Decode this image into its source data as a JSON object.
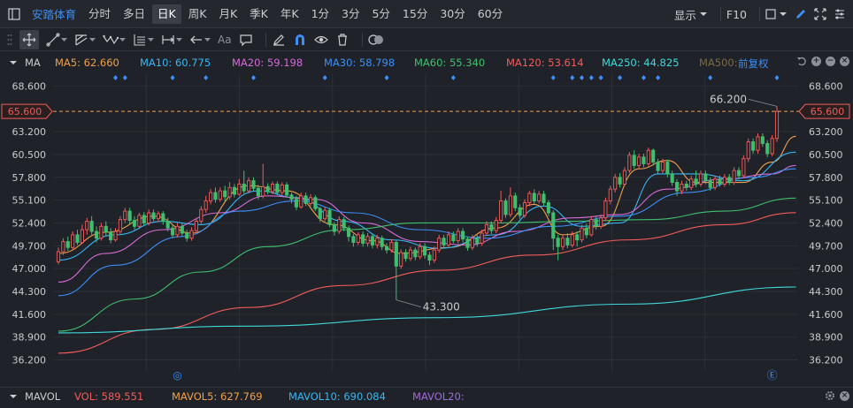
{
  "topbar": {
    "stock_name": "安踏体育",
    "periods": [
      "分时",
      "多日",
      "日K",
      "周K",
      "月K",
      "季K",
      "年K",
      "1分",
      "3分",
      "5分",
      "15分",
      "30分",
      "60分"
    ],
    "active_period": "日K",
    "display_label": "显示",
    "f10_label": "F10"
  },
  "toolbar": {
    "text_tool_label": "Aa"
  },
  "ma_legend": {
    "label": "MA",
    "items": [
      {
        "text": "MA5: 62.660",
        "color": "#f0a04b"
      },
      {
        "text": "MA10: 60.775",
        "color": "#38b6f2"
      },
      {
        "text": "MA20: 59.198",
        "color": "#d66bd6"
      },
      {
        "text": "MA30: 58.798",
        "color": "#3d8ef7"
      },
      {
        "text": "MA60: 55.340",
        "color": "#3fbf6e"
      },
      {
        "text": "MA120: 53.614",
        "color": "#f25b5b"
      },
      {
        "text": "MA250: 44.825",
        "color": "#3fd9d9"
      },
      {
        "text": "MA500:",
        "color": "#7a6a45"
      }
    ],
    "adjust_label": "前复权"
  },
  "vol_legend": {
    "label": "MAVOL",
    "items": [
      {
        "text": "VOL: 589.551",
        "color": "#f25b5b"
      },
      {
        "text": "MAVOL5: 627.769",
        "color": "#f0a04b"
      },
      {
        "text": "MAVOL10: 690.084",
        "color": "#38b6f2"
      },
      {
        "text": "MAVOL20:",
        "color": "#a06bd6"
      }
    ]
  },
  "colors": {
    "up": "#f25b5b",
    "down": "#3fbf6e",
    "grid": "#2b3036",
    "axis_text": "#c9ccd1",
    "accent": "#3d8ef7",
    "crosshair": "#f0a04b"
  },
  "chart_data": {
    "type": "candlestick",
    "ylim": [
      34.9,
      70.0
    ],
    "y_ticks": [
      "68.600",
      "65.600",
      "63.200",
      "60.500",
      "57.800",
      "55.100",
      "52.400",
      "49.700",
      "47.000",
      "44.300",
      "41.600",
      "38.900",
      "36.200"
    ],
    "current_price": "65.600",
    "max_label": "66.200",
    "min_label": "43.300",
    "candles": [
      [
        47.8,
        49.0,
        47.5,
        49.5
      ],
      [
        49.0,
        50.2,
        48.6,
        50.6
      ],
      [
        50.2,
        49.5,
        49.1,
        50.8
      ],
      [
        49.5,
        51.0,
        49.2,
        51.4
      ],
      [
        51.0,
        50.1,
        49.8,
        51.6
      ],
      [
        50.1,
        51.6,
        49.9,
        52.2
      ],
      [
        51.6,
        52.6,
        51.0,
        53.0
      ],
      [
        52.6,
        51.4,
        51.0,
        53.2
      ],
      [
        51.4,
        50.6,
        50.1,
        52.0
      ],
      [
        50.6,
        52.0,
        50.3,
        52.4
      ],
      [
        52.0,
        51.3,
        50.9,
        52.6
      ],
      [
        51.3,
        50.4,
        50.0,
        51.8
      ],
      [
        50.4,
        51.4,
        50.2,
        51.8
      ],
      [
        51.4,
        52.8,
        51.1,
        53.2
      ],
      [
        52.8,
        53.8,
        52.4,
        54.2
      ],
      [
        53.8,
        52.7,
        52.3,
        54.2
      ],
      [
        52.7,
        52.0,
        51.6,
        53.2
      ],
      [
        52.0,
        53.3,
        51.7,
        53.6
      ],
      [
        53.3,
        52.4,
        52.1,
        53.7
      ],
      [
        52.4,
        53.6,
        52.1,
        54.0
      ],
      [
        53.6,
        52.9,
        52.6,
        54.0
      ],
      [
        52.9,
        53.5,
        52.5,
        53.8
      ],
      [
        53.5,
        52.6,
        52.2,
        53.8
      ],
      [
        52.6,
        51.8,
        51.4,
        53.0
      ],
      [
        51.8,
        51.0,
        50.6,
        52.2
      ],
      [
        51.0,
        52.0,
        50.7,
        52.4
      ],
      [
        52.0,
        51.2,
        50.8,
        52.4
      ],
      [
        51.2,
        50.6,
        50.2,
        51.6
      ],
      [
        50.6,
        51.5,
        50.3,
        51.9
      ],
      [
        51.5,
        52.6,
        51.2,
        53.0
      ],
      [
        52.6,
        54.0,
        52.3,
        54.4
      ],
      [
        54.0,
        55.0,
        53.6,
        55.6
      ],
      [
        55.0,
        56.0,
        54.6,
        56.4
      ],
      [
        56.0,
        55.2,
        54.8,
        56.6
      ],
      [
        55.2,
        56.2,
        54.9,
        56.6
      ],
      [
        56.2,
        55.5,
        55.0,
        56.8
      ],
      [
        55.5,
        56.6,
        55.2,
        57.2
      ],
      [
        56.6,
        55.8,
        55.4,
        57.0
      ],
      [
        55.8,
        57.0,
        55.6,
        57.6
      ],
      [
        57.0,
        56.2,
        55.9,
        58.6
      ],
      [
        56.2,
        57.4,
        55.9,
        57.8
      ],
      [
        57.4,
        56.5,
        56.2,
        57.8
      ],
      [
        56.5,
        55.6,
        55.2,
        56.9
      ],
      [
        55.6,
        56.7,
        55.3,
        59.4
      ],
      [
        56.7,
        56.1,
        55.8,
        57.1
      ],
      [
        56.1,
        57.0,
        55.8,
        57.3
      ],
      [
        57.0,
        56.0,
        55.7,
        57.3
      ],
      [
        56.0,
        56.9,
        55.7,
        57.2
      ],
      [
        56.9,
        55.7,
        55.4,
        57.2
      ],
      [
        55.7,
        55.2,
        54.7,
        56.0
      ],
      [
        55.2,
        54.3,
        53.9,
        55.6
      ],
      [
        54.3,
        55.6,
        54.1,
        56.0
      ],
      [
        55.6,
        54.7,
        54.4,
        56.0
      ],
      [
        54.7,
        55.4,
        54.4,
        55.8
      ],
      [
        55.4,
        54.1,
        53.8,
        55.7
      ],
      [
        54.1,
        52.9,
        52.5,
        54.3
      ],
      [
        52.9,
        53.9,
        52.6,
        54.3
      ],
      [
        53.9,
        52.2,
        51.9,
        54.2
      ],
      [
        52.2,
        51.4,
        50.9,
        52.5
      ],
      [
        51.4,
        52.8,
        51.1,
        53.2
      ],
      [
        52.8,
        51.8,
        51.4,
        53.1
      ],
      [
        51.8,
        50.8,
        50.2,
        52.1
      ],
      [
        50.8,
        50.1,
        49.6,
        51.1
      ],
      [
        50.1,
        51.0,
        49.8,
        51.3
      ],
      [
        51.0,
        50.0,
        49.6,
        51.4
      ],
      [
        50.0,
        50.8,
        49.6,
        51.2
      ],
      [
        50.8,
        49.8,
        49.4,
        51.1
      ],
      [
        49.8,
        50.6,
        49.4,
        51.0
      ],
      [
        50.6,
        49.6,
        49.2,
        50.9
      ],
      [
        49.6,
        49.2,
        48.8,
        50.0
      ],
      [
        49.2,
        50.1,
        48.9,
        50.5
      ],
      [
        50.1,
        47.3,
        43.3,
        50.4
      ],
      [
        47.3,
        48.9,
        47.0,
        49.3
      ],
      [
        48.9,
        48.2,
        47.8,
        49.3
      ],
      [
        48.2,
        49.2,
        47.9,
        49.6
      ],
      [
        49.2,
        48.4,
        48.0,
        49.5
      ],
      [
        48.4,
        49.6,
        48.1,
        50.0
      ],
      [
        49.6,
        48.6,
        48.2,
        50.0
      ],
      [
        48.6,
        48.0,
        47.4,
        49.0
      ],
      [
        48.0,
        49.2,
        47.7,
        49.6
      ],
      [
        49.2,
        50.6,
        48.9,
        51.0
      ],
      [
        50.6,
        49.8,
        49.4,
        51.0
      ],
      [
        49.8,
        51.0,
        49.6,
        51.4
      ],
      [
        51.0,
        50.3,
        50.0,
        51.4
      ],
      [
        50.3,
        51.4,
        50.0,
        51.8
      ],
      [
        51.4,
        50.5,
        50.1,
        51.8
      ],
      [
        50.5,
        49.5,
        49.1,
        50.8
      ],
      [
        49.5,
        50.6,
        49.2,
        51.0
      ],
      [
        50.6,
        50.0,
        49.6,
        51.0
      ],
      [
        50.0,
        51.2,
        49.7,
        51.6
      ],
      [
        51.2,
        52.2,
        50.9,
        52.6
      ],
      [
        52.2,
        51.5,
        51.1,
        52.6
      ],
      [
        51.5,
        52.7,
        51.2,
        53.1
      ],
      [
        52.7,
        55.0,
        52.4,
        56.2
      ],
      [
        55.0,
        53.4,
        53.0,
        55.3
      ],
      [
        53.4,
        55.6,
        53.1,
        56.6
      ],
      [
        55.6,
        54.2,
        53.8,
        56.0
      ],
      [
        54.2,
        53.3,
        52.9,
        54.6
      ],
      [
        53.3,
        54.8,
        53.0,
        55.2
      ],
      [
        54.8,
        55.9,
        54.4,
        56.2
      ],
      [
        55.9,
        55.0,
        54.6,
        56.4
      ],
      [
        55.0,
        55.8,
        54.7,
        56.2
      ],
      [
        55.8,
        54.8,
        54.4,
        56.2
      ],
      [
        54.8,
        53.6,
        53.2,
        55.1
      ],
      [
        53.6,
        50.6,
        49.2,
        53.9
      ],
      [
        50.6,
        49.6,
        48.0,
        51.0
      ],
      [
        49.6,
        50.6,
        49.2,
        51.0
      ],
      [
        50.6,
        49.8,
        49.4,
        51.2
      ],
      [
        49.8,
        51.0,
        49.5,
        51.4
      ],
      [
        51.0,
        50.4,
        49.6,
        51.4
      ],
      [
        50.4,
        51.8,
        50.1,
        52.2
      ],
      [
        51.8,
        51.0,
        50.6,
        52.3
      ],
      [
        51.0,
        52.8,
        50.8,
        53.2
      ],
      [
        52.8,
        52.0,
        51.6,
        53.2
      ],
      [
        52.0,
        53.0,
        51.7,
        53.4
      ],
      [
        53.0,
        55.0,
        52.7,
        55.4
      ],
      [
        55.0,
        56.4,
        54.6,
        56.8
      ],
      [
        56.4,
        57.8,
        56.0,
        58.2
      ],
      [
        57.8,
        57.0,
        56.6,
        58.3
      ],
      [
        57.0,
        58.6,
        56.8,
        59.0
      ],
      [
        58.6,
        60.4,
        58.3,
        60.8
      ],
      [
        60.4,
        59.2,
        58.8,
        61.0
      ],
      [
        59.2,
        60.2,
        58.8,
        60.6
      ],
      [
        60.2,
        59.4,
        59.0,
        60.6
      ],
      [
        59.4,
        61.0,
        59.1,
        61.3
      ],
      [
        61.0,
        59.6,
        59.2,
        61.2
      ],
      [
        59.6,
        58.6,
        58.2,
        60.0
      ],
      [
        58.6,
        59.6,
        58.3,
        60.0
      ],
      [
        59.6,
        58.2,
        57.8,
        59.9
      ],
      [
        58.2,
        57.2,
        56.8,
        58.6
      ],
      [
        57.2,
        56.2,
        55.6,
        57.6
      ],
      [
        56.2,
        57.0,
        55.8,
        57.4
      ],
      [
        57.0,
        56.6,
        56.2,
        57.4
      ],
      [
        56.6,
        57.6,
        56.3,
        58.0
      ],
      [
        57.6,
        57.0,
        56.6,
        58.6
      ],
      [
        57.0,
        58.2,
        56.7,
        58.6
      ],
      [
        58.2,
        57.4,
        57.0,
        58.6
      ],
      [
        57.4,
        56.6,
        56.2,
        57.8
      ],
      [
        56.6,
        57.6,
        56.3,
        58.0
      ],
      [
        57.6,
        57.0,
        56.7,
        58.0
      ],
      [
        57.0,
        57.8,
        56.7,
        58.2
      ],
      [
        57.8,
        57.2,
        56.9,
        58.2
      ],
      [
        57.2,
        58.6,
        56.9,
        59.0
      ],
      [
        58.6,
        58.0,
        57.6,
        59.0
      ],
      [
        58.0,
        60.0,
        57.7,
        60.4
      ],
      [
        60.0,
        62.0,
        59.6,
        62.4
      ],
      [
        62.0,
        61.0,
        60.6,
        62.4
      ],
      [
        61.0,
        62.6,
        60.6,
        63.0
      ],
      [
        62.6,
        61.8,
        61.4,
        63.0
      ],
      [
        61.8,
        60.6,
        60.2,
        62.2
      ],
      [
        60.6,
        62.4,
        60.3,
        62.8
      ],
      [
        62.4,
        65.6,
        62.0,
        66.2
      ]
    ],
    "ma_series": {
      "MA5": [
        [
          0,
          48.8
        ],
        [
          10,
          51.3
        ],
        [
          20,
          53.2
        ],
        [
          28,
          51.2
        ],
        [
          40,
          56.8
        ],
        [
          48,
          56.2
        ],
        [
          58,
          52.2
        ],
        [
          66,
          50.3
        ],
        [
          72,
          48.8
        ],
        [
          82,
          49.5
        ],
        [
          92,
          51.8
        ],
        [
          100,
          54.6
        ],
        [
          106,
          51.0
        ],
        [
          114,
          52.0
        ],
        [
          122,
          58.8
        ],
        [
          128,
          59.8
        ],
        [
          134,
          57.2
        ],
        [
          144,
          57.2
        ],
        [
          150,
          59.6
        ],
        [
          155,
          62.66
        ]
      ],
      "MA10": [
        [
          0,
          48.0
        ],
        [
          12,
          51.0
        ],
        [
          22,
          52.6
        ],
        [
          30,
          52.2
        ],
        [
          42,
          56.2
        ],
        [
          50,
          55.4
        ],
        [
          60,
          52.6
        ],
        [
          70,
          50.4
        ],
        [
          80,
          49.4
        ],
        [
          92,
          51.0
        ],
        [
          102,
          54.4
        ],
        [
          110,
          52.0
        ],
        [
          118,
          52.4
        ],
        [
          126,
          58.2
        ],
        [
          134,
          58.2
        ],
        [
          144,
          57.4
        ],
        [
          155,
          60.775
        ]
      ],
      "MA20": [
        [
          0,
          45.4
        ],
        [
          10,
          48.8
        ],
        [
          22,
          51.6
        ],
        [
          34,
          53.6
        ],
        [
          44,
          55.6
        ],
        [
          54,
          55.2
        ],
        [
          64,
          52.4
        ],
        [
          76,
          50.2
        ],
        [
          86,
          49.8
        ],
        [
          96,
          51.4
        ],
        [
          108,
          53.0
        ],
        [
          118,
          53.4
        ],
        [
          128,
          56.4
        ],
        [
          140,
          57.6
        ],
        [
          150,
          58.2
        ],
        [
          155,
          59.198
        ]
      ],
      "MA30": [
        [
          0,
          43.8
        ],
        [
          12,
          47.4
        ],
        [
          26,
          50.8
        ],
        [
          38,
          53.8
        ],
        [
          50,
          55.0
        ],
        [
          62,
          53.6
        ],
        [
          76,
          51.6
        ],
        [
          90,
          50.6
        ],
        [
          104,
          52.0
        ],
        [
          118,
          53.2
        ],
        [
          132,
          56.0
        ],
        [
          146,
          57.8
        ],
        [
          155,
          58.798
        ]
      ],
      "MA60": [
        [
          0,
          39.6
        ],
        [
          16,
          43.4
        ],
        [
          30,
          46.6
        ],
        [
          44,
          49.6
        ],
        [
          60,
          51.6
        ],
        [
          76,
          52.4
        ],
        [
          92,
          52.4
        ],
        [
          108,
          52.6
        ],
        [
          124,
          52.8
        ],
        [
          140,
          53.8
        ],
        [
          155,
          55.34
        ]
      ],
      "MA120": [
        [
          0,
          37.0
        ],
        [
          20,
          39.8
        ],
        [
          40,
          42.4
        ],
        [
          60,
          45.0
        ],
        [
          80,
          46.8
        ],
        [
          100,
          48.6
        ],
        [
          120,
          50.4
        ],
        [
          140,
          52.2
        ],
        [
          155,
          53.614
        ]
      ],
      "MA250": [
        [
          0,
          39.4
        ],
        [
          40,
          40.2
        ],
        [
          80,
          41.2
        ],
        [
          120,
          42.8
        ],
        [
          155,
          44.825
        ]
      ]
    },
    "markers_top_idx": [
      12,
      14,
      24,
      31,
      41,
      56,
      69,
      83,
      104,
      108,
      110,
      112,
      114,
      118,
      123,
      126,
      137,
      151
    ],
    "bottom_markers": [
      {
        "glyph": "◎",
        "idx": 25
      },
      {
        "glyph": "Ⓔ",
        "idx": 150
      }
    ]
  }
}
